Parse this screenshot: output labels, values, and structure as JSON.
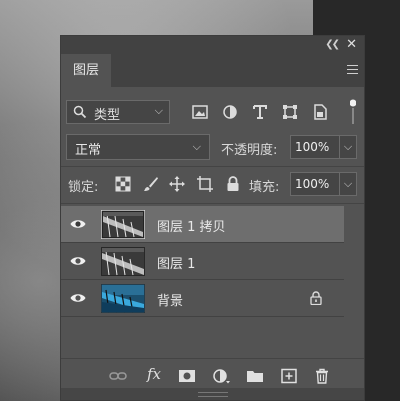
{
  "panel": {
    "tab_label": "图层",
    "collapse_icon": "double-chevron-right-icon",
    "close_icon": "close-icon",
    "menu_icon": "hamburger-menu-icon"
  },
  "filter": {
    "kind_label": "类型",
    "icons": [
      "image-filter-icon",
      "adjustment-filter-icon",
      "type-filter-icon",
      "shape-filter-icon",
      "smart-object-filter-icon"
    ]
  },
  "blend": {
    "mode": "正常",
    "opacity_label": "不透明度:",
    "opacity_value": "100%"
  },
  "lock": {
    "label": "锁定:",
    "icons": [
      "lock-transparent-pixels-icon",
      "lock-image-pixels-icon",
      "lock-position-icon",
      "lock-artboard-icon",
      "lock-all-icon"
    ],
    "fill_label": "填充:",
    "fill_value": "100%"
  },
  "layers": [
    {
      "name": "图层 1 拷贝",
      "selected": true,
      "visible": true,
      "locked": false
    },
    {
      "name": "图层 1",
      "selected": false,
      "visible": true,
      "locked": false
    },
    {
      "name": "背景",
      "selected": false,
      "visible": true,
      "locked": true
    }
  ],
  "bottom_icons": [
    "link-layers-icon",
    "fx-icon",
    "add-mask-icon",
    "new-adjustment-layer-icon",
    "new-group-icon",
    "new-layer-icon",
    "delete-layer-icon"
  ],
  "bottom_labels": {
    "fx": "fx"
  },
  "colors": {
    "panel_bg": "#535353",
    "selected_row": "#6e6e6e",
    "field_bg": "#454545"
  }
}
